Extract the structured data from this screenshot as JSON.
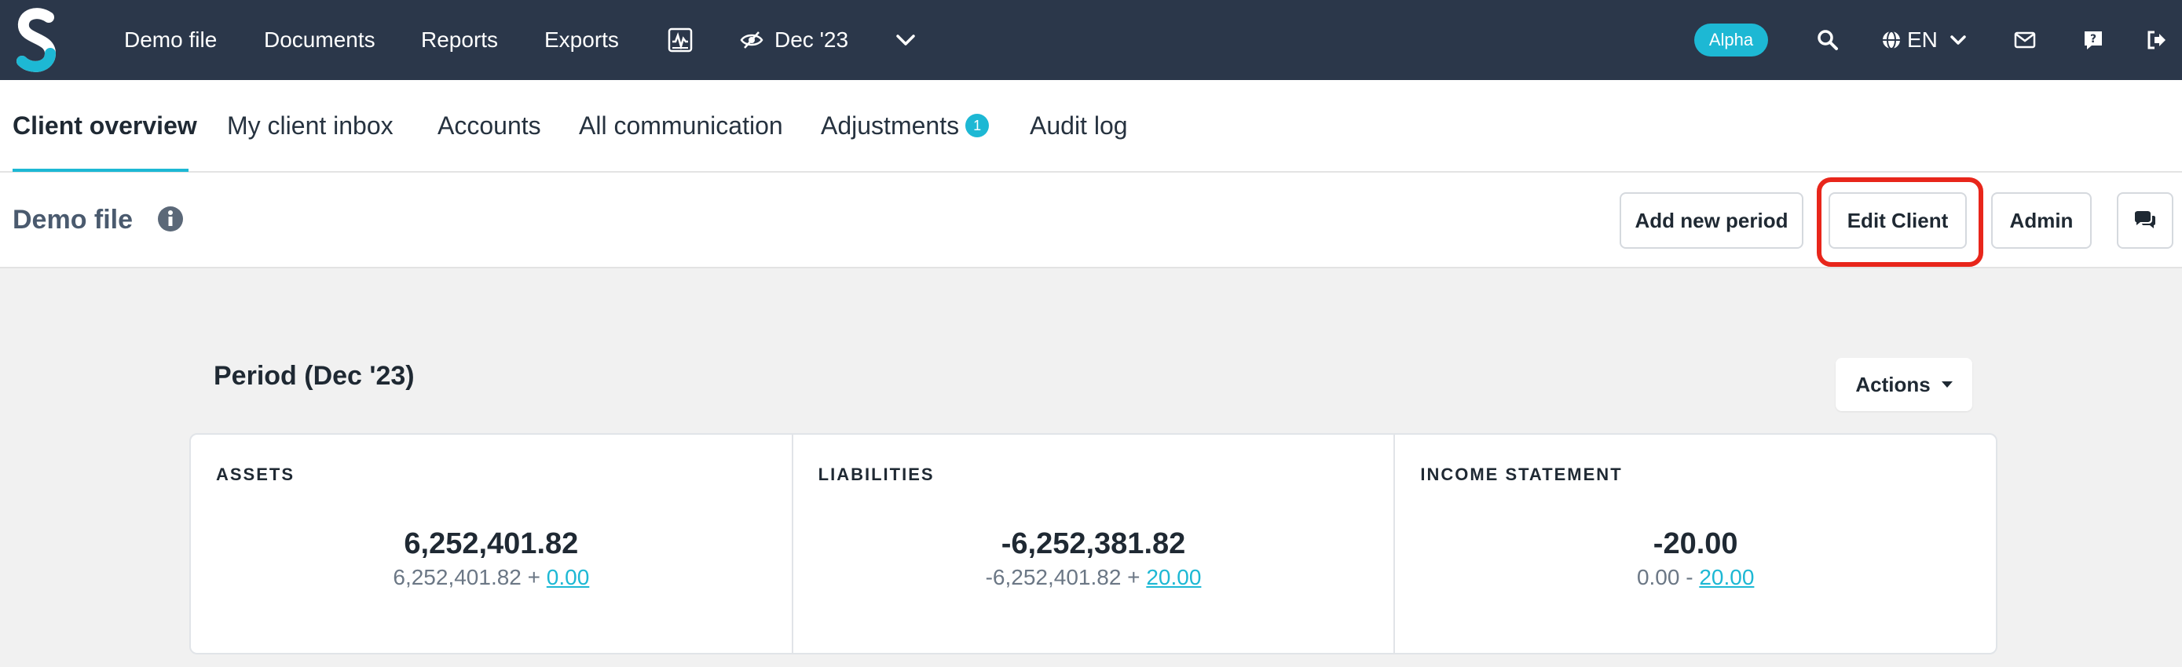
{
  "nav": {
    "links": {
      "demo_file": "Demo file",
      "documents": "Documents",
      "reports": "Reports",
      "exports": "Exports"
    },
    "period_label": "Dec '23",
    "badge": "Alpha",
    "language": "EN",
    "icons": [
      "logo-icon",
      "activity-chart-icon",
      "eye-slash-icon",
      "chevron-down-icon",
      "search-icon",
      "globe-icon",
      "envelope-icon",
      "question-icon",
      "logout-icon"
    ]
  },
  "tabs": [
    {
      "label": "Client overview",
      "active": true
    },
    {
      "label": "My client inbox"
    },
    {
      "label": "Accounts"
    },
    {
      "label": "All communication"
    },
    {
      "label": "Adjustments",
      "count": "1"
    },
    {
      "label": "Audit log"
    }
  ],
  "header": {
    "title": "Demo file",
    "buttons": {
      "add_period": "Add new period",
      "edit_client": "Edit Client",
      "admin": "Admin"
    }
  },
  "period": {
    "title": "Period (Dec '23)",
    "actions_label": "Actions",
    "cards": [
      {
        "label": "ASSETS",
        "total": "6,252,401.82",
        "base": "6,252,401.82",
        "op": " + ",
        "adjust": "0.00"
      },
      {
        "label": "LIABILITIES",
        "total": "-6,252,381.82",
        "base": "-6,252,401.82",
        "op": " + ",
        "adjust": "20.00"
      },
      {
        "label": "INCOME STATEMENT",
        "total": "-20.00",
        "base": "0.00",
        "op": " - ",
        "adjust": "20.00"
      }
    ]
  },
  "colors": {
    "nav_bg": "#2b374a",
    "accent": "#1db8d4",
    "highlight": "#e8261b"
  }
}
